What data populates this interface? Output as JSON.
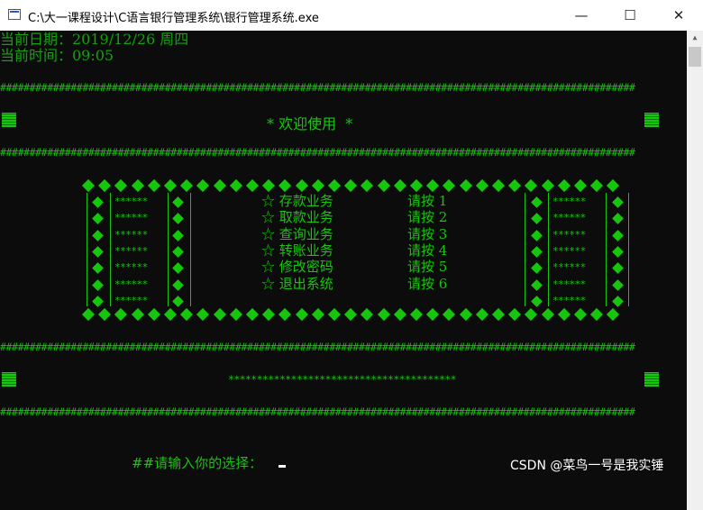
{
  "window": {
    "title": "C:\\大一课程设计\\C语言银行管理系统\\银行管理系统.exe",
    "controls": {
      "minimize": "—",
      "maximize": "☐",
      "close": "✕"
    }
  },
  "console": {
    "date_line": "当前日期：2019/12/26 周四",
    "time_line": "当前时间：09:05",
    "hash_border": "############################################################################################################",
    "welcome": "* 欢迎使用  *",
    "menu": [
      {
        "label": "☆ 存款业务",
        "key": "请按 1"
      },
      {
        "label": "☆ 取款业务",
        "key": "请按 2"
      },
      {
        "label": "☆ 查询业务",
        "key": "请按 3"
      },
      {
        "label": "☆ 转账业务",
        "key": "请按 4"
      },
      {
        "label": "☆ 修改密码",
        "key": "请按 5"
      },
      {
        "label": "☆ 退出系统",
        "key": "请按 6"
      }
    ],
    "side_stars": "******",
    "star_line": "****************************************",
    "prompt": "##请输入你的选择：",
    "colors": {
      "text": "#16c60c",
      "background": "#0c0c0c"
    }
  },
  "watermark": "CSDN @菜鸟一号是我实锤"
}
